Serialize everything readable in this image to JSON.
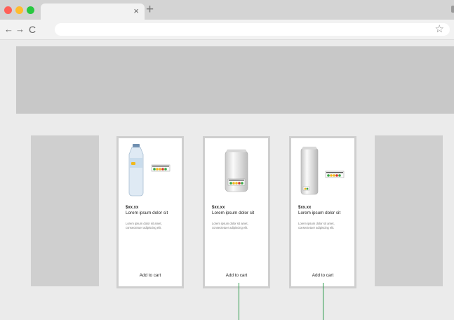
{
  "browser": {
    "tab": {
      "title": "",
      "close_glyph": "×"
    },
    "new_tab_glyph": "+",
    "toolbar": {
      "back_glyph": "←",
      "forward_glyph": "→",
      "reload_glyph": "C",
      "url": "",
      "bookmark_glyph": "☆"
    }
  },
  "products": [
    {
      "image": "water-bottle",
      "price": "$xx.xx",
      "title": "Lorem ipsum dolor sit",
      "description": "Lorem ipsum dolor sit amet, consectetuer adipiscing elit.",
      "cta": "Add to cart"
    },
    {
      "image": "beverage-can",
      "price": "$xx.xx",
      "title": "Lorem ipsum dolor sit",
      "description": "Lorem ipsum dolor sit amet, consectetuer adipiscing elit.",
      "cta": "Add to cart"
    },
    {
      "image": "tall-beverage-can",
      "price": "$xx.xx",
      "title": "Lorem ipsum dolor sit",
      "description": "Lorem ipsum dolor sit amet, consectetuer adipiscing elit.",
      "cta": "Add to cart"
    }
  ],
  "colors": {
    "accent_line": "#2a9a4a",
    "placeholder": "#c8c8c8",
    "nutrition_red": "#d83a2a",
    "nutrition_amber": "#f1b81c",
    "nutrition_green": "#3aa845"
  }
}
